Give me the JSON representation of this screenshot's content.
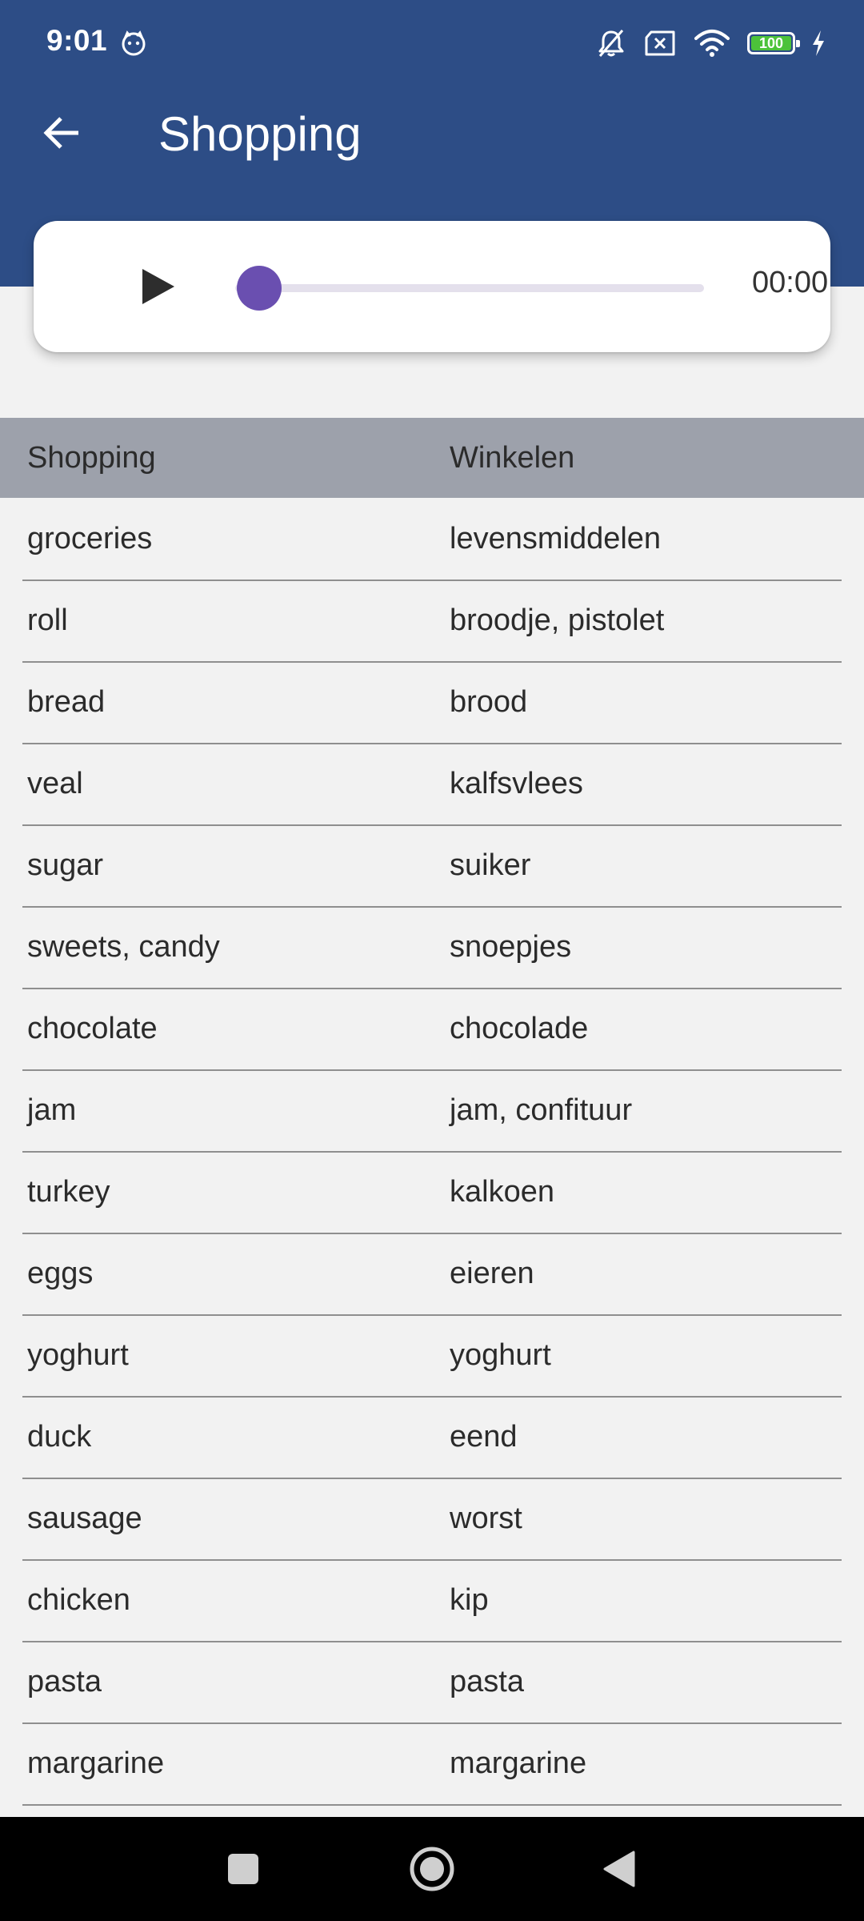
{
  "status_bar": {
    "time": "9:01",
    "battery_level": "100",
    "icons": [
      "cat-notification-icon",
      "bell-muted-icon",
      "sim-x-icon",
      "wifi-icon",
      "battery-icon",
      "charging-bolt-icon"
    ]
  },
  "toolbar": {
    "title": "Shopping",
    "back_icon": "arrow-back-icon"
  },
  "player": {
    "play_icon": "play-icon",
    "progress": 0,
    "time": "00:00",
    "accent_color": "#6a4fb0"
  },
  "table": {
    "headers": [
      "Shopping",
      "Winkelen"
    ],
    "rows": [
      [
        "groceries",
        "levensmiddelen"
      ],
      [
        "roll",
        "broodje, pistolet"
      ],
      [
        "bread",
        "brood"
      ],
      [
        "veal",
        "kalfsvlees"
      ],
      [
        "sugar",
        "suiker"
      ],
      [
        "sweets, candy",
        "snoepjes"
      ],
      [
        "chocolate",
        "chocolade"
      ],
      [
        "jam",
        "jam, confituur"
      ],
      [
        "turkey",
        "kalkoen"
      ],
      [
        "eggs",
        "eieren"
      ],
      [
        "yoghurt",
        "yoghurt"
      ],
      [
        "duck",
        "eend"
      ],
      [
        "sausage",
        "worst"
      ],
      [
        "chicken",
        "kip"
      ],
      [
        "pasta",
        "pasta"
      ],
      [
        "margarine",
        "margarine"
      ]
    ]
  },
  "nav_bar": {
    "buttons": [
      "recents-square-icon",
      "home-circle-icon",
      "back-triangle-icon"
    ]
  },
  "colors": {
    "app_bar": "#2d4d86",
    "table_header": "#9da1ab",
    "background": "#f2f2f2"
  }
}
